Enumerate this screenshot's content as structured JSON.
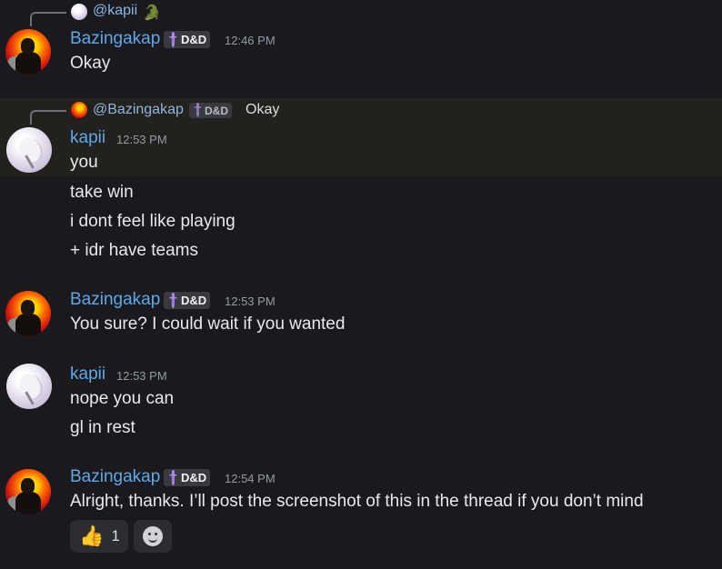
{
  "messages": [
    {
      "reply": {
        "author": "@kapii",
        "emoji": "🐊"
      },
      "author": "Bazingakap",
      "tag": "D&D",
      "time": "12:46 PM",
      "lines": [
        "Okay"
      ]
    },
    {
      "reply": {
        "author": "@Bazingakap",
        "tag": "D&D",
        "text": "Okay"
      },
      "author": "kapii",
      "time": "12:53 PM",
      "lines": [
        "you",
        "take win",
        "i dont feel like playing",
        "+ idr have teams"
      ]
    },
    {
      "author": "Bazingakap",
      "tag": "D&D",
      "time": "12:53 PM",
      "lines": [
        "You sure? I  could wait if you wanted"
      ]
    },
    {
      "author": "kapii",
      "time": "12:53 PM",
      "lines": [
        "nope you can",
        "gl in rest"
      ]
    },
    {
      "author": "Bazingakap",
      "tag": "D&D",
      "time": "12:54 PM",
      "lines": [
        "Alright, thanks. I’ll post the screenshot of this in the thread if you don’t mind"
      ],
      "reactions": [
        {
          "emoji": "👍",
          "count": "1"
        }
      ]
    }
  ],
  "colors": {
    "background": "#1a1a1e",
    "highlight": "#23211e",
    "username": "#5fa9e8",
    "timestamp": "#949ba4",
    "reaction_bg": "#2b2d31"
  },
  "icons": [
    "crocodile-emoji",
    "sword-icon",
    "thumbs-up-emoji",
    "add-reaction-icon"
  ]
}
